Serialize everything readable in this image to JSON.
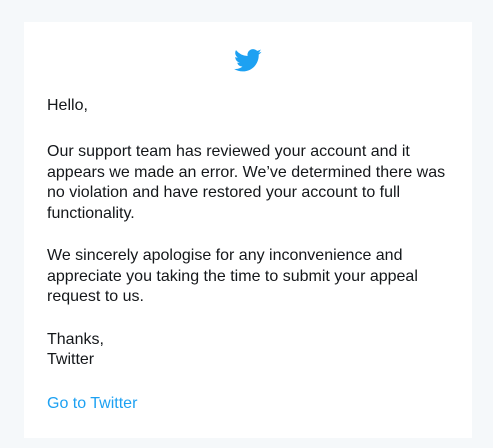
{
  "email": {
    "logo_icon": "twitter-bird-icon",
    "brand_color": "#1da1f2",
    "greeting": "Hello,",
    "paragraph_1": "Our support team has reviewed your account and it appears we made an error. We’ve determined there was no violation and have restored your account to full functionality.",
    "paragraph_2": "We sincerely apologise for any inconvenience and appreciate you taking the time to submit your appeal request to us.",
    "signoff_line_1": "Thanks,",
    "signoff_line_2": "Twitter",
    "cta_link": "Go to Twitter"
  }
}
